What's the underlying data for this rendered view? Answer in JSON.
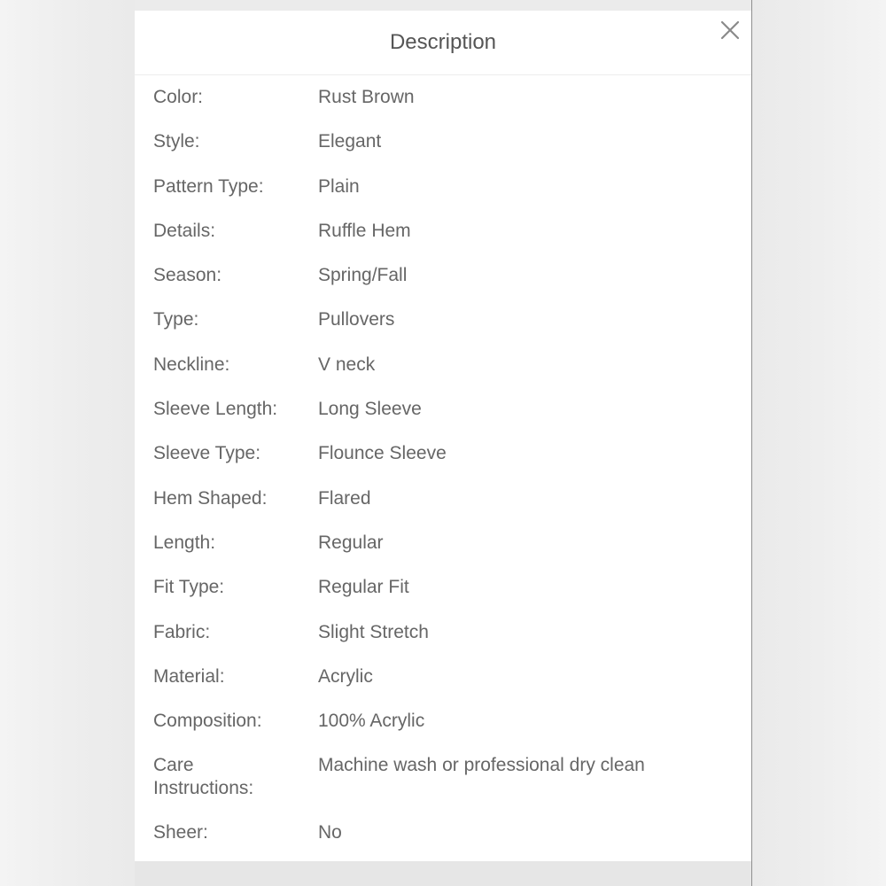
{
  "modal": {
    "title": "Description",
    "close_icon": "close-icon"
  },
  "specs": [
    {
      "label": "Color:",
      "value": "Rust Brown"
    },
    {
      "label": "Style:",
      "value": "Elegant"
    },
    {
      "label": "Pattern Type:",
      "value": "Plain"
    },
    {
      "label": "Details:",
      "value": "Ruffle Hem"
    },
    {
      "label": "Season:",
      "value": "Spring/Fall"
    },
    {
      "label": "Type:",
      "value": "Pullovers"
    },
    {
      "label": "Neckline:",
      "value": "V neck"
    },
    {
      "label": "Sleeve Length:",
      "value": "Long Sleeve"
    },
    {
      "label": "Sleeve Type:",
      "value": "Flounce Sleeve"
    },
    {
      "label": "Hem Shaped:",
      "value": "Flared"
    },
    {
      "label": "Length:",
      "value": "Regular"
    },
    {
      "label": "Fit Type:",
      "value": "Regular Fit"
    },
    {
      "label": "Fabric:",
      "value": "Slight Stretch"
    },
    {
      "label": "Material:",
      "value": "Acrylic"
    },
    {
      "label": "Composition:",
      "value": "100% Acrylic"
    },
    {
      "label": "Care Instructions:",
      "value": "Machine wash or professional dry clean"
    },
    {
      "label": "Sheer:",
      "value": "No"
    }
  ],
  "colors": {
    "text": "#666666",
    "title": "#555555",
    "close": "#8a8a8a",
    "backdrop": "#f1f1f1"
  }
}
